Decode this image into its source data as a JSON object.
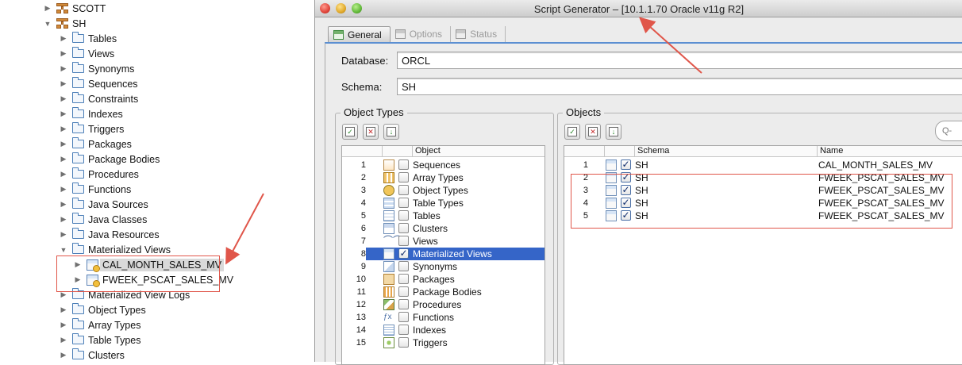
{
  "tree": {
    "items": [
      {
        "label": "SCOTT",
        "icon": "schema-icon",
        "expanded": false
      },
      {
        "label": "SH",
        "icon": "schema-icon",
        "expanded": true
      },
      {
        "label": "Tables",
        "icon": "folder-icon",
        "expanded": false
      },
      {
        "label": "Views",
        "icon": "folder-icon",
        "expanded": false
      },
      {
        "label": "Synonyms",
        "icon": "folder-icon",
        "expanded": false
      },
      {
        "label": "Sequences",
        "icon": "folder-icon",
        "expanded": false
      },
      {
        "label": "Constraints",
        "icon": "folder-icon",
        "expanded": false
      },
      {
        "label": "Indexes",
        "icon": "folder-icon",
        "expanded": false
      },
      {
        "label": "Triggers",
        "icon": "folder-icon",
        "expanded": false
      },
      {
        "label": "Packages",
        "icon": "folder-icon",
        "expanded": false
      },
      {
        "label": "Package Bodies",
        "icon": "folder-icon",
        "expanded": false
      },
      {
        "label": "Procedures",
        "icon": "folder-icon",
        "expanded": false
      },
      {
        "label": "Functions",
        "icon": "folder-icon",
        "expanded": false
      },
      {
        "label": "Java Sources",
        "icon": "folder-icon",
        "expanded": false
      },
      {
        "label": "Java Classes",
        "icon": "folder-icon",
        "expanded": false
      },
      {
        "label": "Java Resources",
        "icon": "folder-icon",
        "expanded": false
      },
      {
        "label": "Materialized Views",
        "icon": "folder-icon",
        "expanded": true
      },
      {
        "label": "CAL_MONTH_SALES_MV",
        "icon": "materialized-view-icon",
        "expanded": false,
        "selected": true
      },
      {
        "label": "FWEEK_PSCAT_SALES_MV",
        "icon": "materialized-view-icon",
        "expanded": false
      },
      {
        "label": "Materialized View Logs",
        "icon": "folder-icon",
        "expanded": false
      },
      {
        "label": "Object Types",
        "icon": "folder-icon",
        "expanded": false
      },
      {
        "label": "Array Types",
        "icon": "folder-icon",
        "expanded": false
      },
      {
        "label": "Table Types",
        "icon": "folder-icon",
        "expanded": false
      },
      {
        "label": "Clusters",
        "icon": "folder-icon",
        "expanded": false
      }
    ]
  },
  "dialog": {
    "title": "Script Generator – [10.1.1.70 Oracle  v11g R2]",
    "tabs": [
      {
        "label": "General",
        "active": true
      },
      {
        "label": "Options",
        "active": false
      },
      {
        "label": "Status",
        "active": false
      }
    ],
    "database": {
      "label": "Database:",
      "value": "ORCL"
    },
    "schema": {
      "label": "Schema:",
      "value": "SH"
    },
    "object_types": {
      "title": "Object Types",
      "column_header": "Object",
      "rows": [
        {
          "n": "1",
          "label": "Sequences",
          "checked": false,
          "icon": "sequence-icon"
        },
        {
          "n": "2",
          "label": "Array Types",
          "checked": false,
          "icon": "array-type-icon"
        },
        {
          "n": "3",
          "label": "Object Types",
          "checked": false,
          "icon": "object-type-icon"
        },
        {
          "n": "4",
          "label": "Table Types",
          "checked": false,
          "icon": "table-type-icon"
        },
        {
          "n": "5",
          "label": "Tables",
          "checked": false,
          "icon": "table-icon"
        },
        {
          "n": "6",
          "label": "Clusters",
          "checked": false,
          "icon": "cluster-icon"
        },
        {
          "n": "7",
          "label": "Views",
          "checked": false,
          "icon": "view-icon"
        },
        {
          "n": "8",
          "label": "Materialized Views",
          "checked": true,
          "icon": "materialized-view-icon",
          "selected": true
        },
        {
          "n": "9",
          "label": "Synonyms",
          "checked": false,
          "icon": "synonym-icon"
        },
        {
          "n": "10",
          "label": "Packages",
          "checked": false,
          "icon": "package-icon"
        },
        {
          "n": "11",
          "label": "Package Bodies",
          "checked": false,
          "icon": "package-body-icon"
        },
        {
          "n": "12",
          "label": "Procedures",
          "checked": false,
          "icon": "procedure-icon"
        },
        {
          "n": "13",
          "label": "Functions",
          "checked": false,
          "icon": "function-icon"
        },
        {
          "n": "14",
          "label": "Indexes",
          "checked": false,
          "icon": "index-icon"
        },
        {
          "n": "15",
          "label": "Triggers",
          "checked": false,
          "icon": "trigger-icon"
        }
      ]
    },
    "objects": {
      "title": "Objects",
      "columns": [
        "Schema",
        "Name"
      ],
      "search_placeholder": "Q-",
      "rows": [
        {
          "n": "1",
          "schema": "SH",
          "name": "CAL_MONTH_SALES_MV",
          "checked": true
        },
        {
          "n": "2",
          "schema": "SH",
          "name": "FWEEK_PSCAT_SALES_MV",
          "checked": true
        },
        {
          "n": "3",
          "schema": "SH",
          "name": "FWEEK_PSCAT_SALES_MV",
          "checked": true
        },
        {
          "n": "4",
          "schema": "SH",
          "name": "FWEEK_PSCAT_SALES_MV",
          "checked": true
        },
        {
          "n": "5",
          "schema": "SH",
          "name": "FWEEK_PSCAT_SALES_MV",
          "checked": true
        }
      ]
    }
  },
  "colors": {
    "selection": "#3565c8",
    "tab_accent": "#5b8fd2",
    "annotation_red": "#e0564a"
  }
}
